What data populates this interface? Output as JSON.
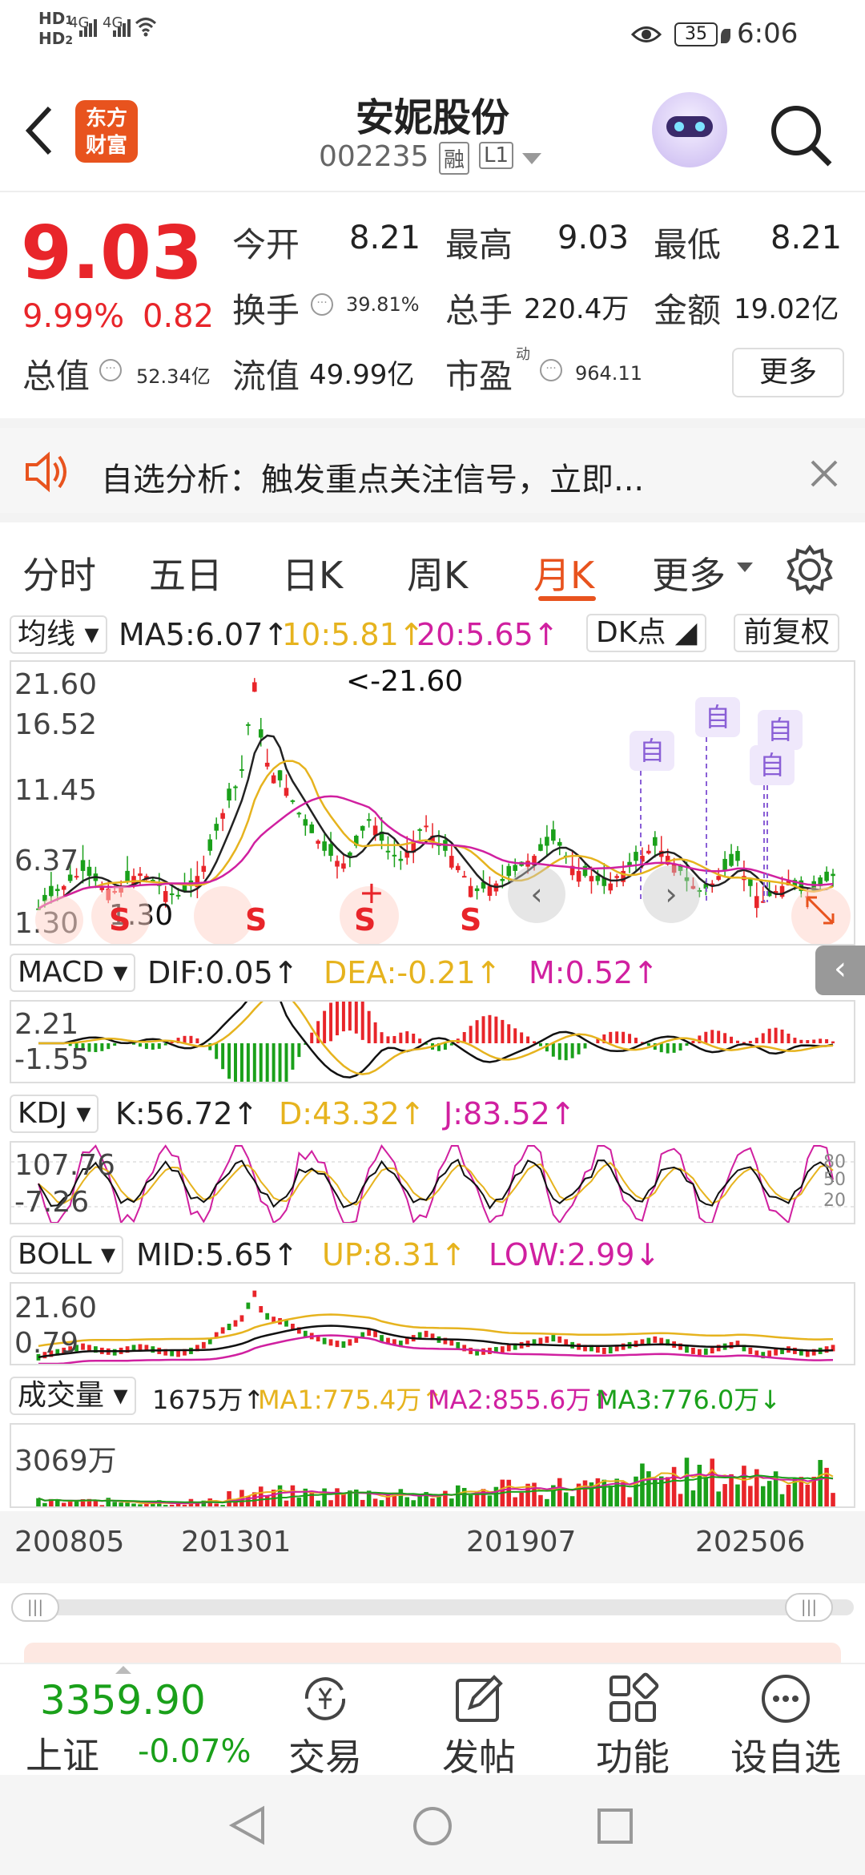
{
  "status": {
    "sim1": "HD",
    "sim1_sub": "1",
    "sim2": "HD",
    "sim2_sub": "2",
    "net1": "4G",
    "net2": "4G",
    "battery": "35",
    "time": "6:06"
  },
  "header": {
    "logo_line1": "东方",
    "logo_line2": "财富",
    "title": "安妮股份",
    "code": "002235",
    "tag_rong": "融",
    "tag_level": "L1"
  },
  "quote": {
    "price": "9.03",
    "pct": "9.99%",
    "change": "0.82",
    "open_label": "今开",
    "open": "8.21",
    "high_label": "最高",
    "high": "9.03",
    "low_label": "最低",
    "low": "8.21",
    "turnover_label": "换手",
    "turnover": "39.81%",
    "volume_label": "总手",
    "volume": "220.4万",
    "amount_label": "金额",
    "amount": "19.02亿",
    "mktcap_label": "总值",
    "mktcap": "52.34亿",
    "float_label": "流值",
    "float": "49.99亿",
    "pe_label": "市盈",
    "pe_sup": "动",
    "pe": "964.11",
    "more": "更多"
  },
  "banner": {
    "text": "自选分析：触发重点关注信号，立即..."
  },
  "tabs": [
    "分时",
    "五日",
    "日K",
    "周K",
    "月K",
    "更多"
  ],
  "active_tab": "月K",
  "ma": {
    "dropdown": "均线",
    "ma5": "MA5:6.07↑",
    "ma10": "10:5.81↑",
    "ma20": "20:5.65↑",
    "dk": "DK点",
    "fq": "前复权",
    "colors": {
      "ma5": "#222222",
      "ma10": "#e6b31e",
      "ma20": "#d020a0"
    }
  },
  "kchart": {
    "y_top": "21.60",
    "y2": "16.52",
    "y3": "11.45",
    "y4": "6.37",
    "y5": "1.30",
    "peak": "<-21.60",
    "low": "1.30",
    "s": "S",
    "plus": "+",
    "zi": "自"
  },
  "macd": {
    "dropdown": "MACD",
    "dif": "DIF:0.05↑",
    "dea": "DEA:-0.21↑",
    "m": "M:0.52↑",
    "y_top": "2.21",
    "y_bot": "-1.55"
  },
  "kdj": {
    "dropdown": "KDJ",
    "k": "K:56.72↑",
    "d": "D:43.32↑",
    "j": "J:83.52↑",
    "y_top": "107.76",
    "y_bot": "-7.26",
    "r80": "80",
    "r50": "50",
    "r20": "20"
  },
  "boll": {
    "dropdown": "BOLL",
    "mid": "MID:5.65↑",
    "up": "UP:8.31↑",
    "low": "LOW:2.99↓",
    "y_top": "21.60",
    "y_bot": "0.79"
  },
  "vol": {
    "dropdown": "成交量",
    "v": "1675万↑",
    "ma1": "MA1:775.4万↑",
    "ma2": "MA2:855.6万↑",
    "ma3": "MA3:776.0万↓",
    "y_top": "3069万"
  },
  "xaxis": [
    "200805",
    "201301",
    "201907",
    "202506"
  ],
  "index": {
    "value": "3359.90",
    "name": "上证",
    "change": "-0.07%"
  },
  "bottom": {
    "trade": "交易",
    "post": "发帖",
    "func": "功能",
    "watch": "设自选"
  },
  "chart_data": {
    "type": "line",
    "title": "",
    "categories": [
      "200805",
      "201301",
      "201907",
      "202506"
    ],
    "series": [
      {
        "name": "MA5:6.07",
        "values": [
          6.07
        ]
      },
      {
        "name": "10:5.81",
        "values": [
          5.81
        ]
      },
      {
        "name": "20:5.65",
        "values": [
          5.65
        ]
      }
    ],
    "ylim": [
      1.3,
      21.6
    ],
    "xlabel": "",
    "ylabel": ""
  }
}
